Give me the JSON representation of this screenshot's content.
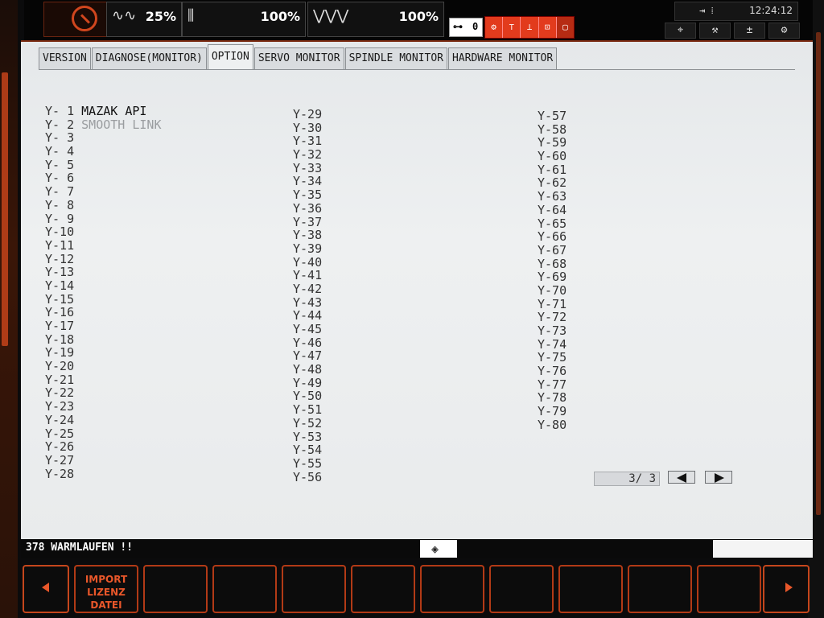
{
  "topbar": {
    "feed_override": "25%",
    "spindle_override": "100%",
    "rapid_override": "100%",
    "key_status": "0",
    "clock": "12:24:12",
    "icons": [
      "alarm-icon",
      "feed-wave-icon",
      "spindle-icon",
      "rapid-wave-icon",
      "key-icon",
      "position-icon",
      "tool-icon",
      "adjust-icon",
      "settings-icon"
    ]
  },
  "tabs": [
    "VERSION",
    "DIAGNOSE(MONITOR)",
    "OPTION",
    "SERVO MONITOR",
    "SPINDLE MONITOR",
    "HARDWARE MONITOR"
  ],
  "active_tab": "OPTION",
  "options_col1": [
    {
      "id": "Y- 1",
      "name": "MAZAK API"
    },
    {
      "id": "Y- 2",
      "name": "SMOOTH LINK"
    },
    {
      "id": "Y- 3",
      "name": ""
    },
    {
      "id": "Y- 4",
      "name": ""
    },
    {
      "id": "Y- 5",
      "name": ""
    },
    {
      "id": "Y- 6",
      "name": ""
    },
    {
      "id": "Y- 7",
      "name": ""
    },
    {
      "id": "Y- 8",
      "name": ""
    },
    {
      "id": "Y- 9",
      "name": ""
    },
    {
      "id": "Y-10",
      "name": ""
    },
    {
      "id": "Y-11",
      "name": ""
    },
    {
      "id": "Y-12",
      "name": ""
    },
    {
      "id": "Y-13",
      "name": ""
    },
    {
      "id": "Y-14",
      "name": ""
    },
    {
      "id": "Y-15",
      "name": ""
    },
    {
      "id": "Y-16",
      "name": ""
    },
    {
      "id": "Y-17",
      "name": ""
    },
    {
      "id": "Y-18",
      "name": ""
    },
    {
      "id": "Y-19",
      "name": ""
    },
    {
      "id": "Y-20",
      "name": ""
    },
    {
      "id": "Y-21",
      "name": ""
    },
    {
      "id": "Y-22",
      "name": ""
    },
    {
      "id": "Y-23",
      "name": ""
    },
    {
      "id": "Y-24",
      "name": ""
    },
    {
      "id": "Y-25",
      "name": ""
    },
    {
      "id": "Y-26",
      "name": ""
    },
    {
      "id": "Y-27",
      "name": ""
    },
    {
      "id": "Y-28",
      "name": ""
    }
  ],
  "options_col2": [
    "Y-29",
    "Y-30",
    "Y-31",
    "Y-32",
    "Y-33",
    "Y-34",
    "Y-35",
    "Y-36",
    "Y-37",
    "Y-38",
    "Y-39",
    "Y-40",
    "Y-41",
    "Y-42",
    "Y-43",
    "Y-44",
    "Y-45",
    "Y-46",
    "Y-47",
    "Y-48",
    "Y-49",
    "Y-50",
    "Y-51",
    "Y-52",
    "Y-53",
    "Y-54",
    "Y-55",
    "Y-56"
  ],
  "options_col3": [
    "Y-57",
    "Y-58",
    "Y-59",
    "Y-60",
    "Y-61",
    "Y-62",
    "Y-63",
    "Y-64",
    "Y-65",
    "Y-66",
    "Y-67",
    "Y-68",
    "Y-69",
    "Y-70",
    "Y-71",
    "Y-72",
    "Y-73",
    "Y-74",
    "Y-75",
    "Y-76",
    "Y-77",
    "Y-78",
    "Y-79",
    "Y-80"
  ],
  "pager": {
    "text": "3/  3"
  },
  "message": "378 WARMLAUFEN !!",
  "softkeys": [
    "IMPORT\nLIZENZ\nDATEI",
    "",
    "",
    "",
    "",
    "",
    "",
    "",
    "",
    "",
    ""
  ],
  "colors": {
    "accent": "#e9572a",
    "status_red": "#e23b1d",
    "screen_bg": "#e9ebec"
  }
}
